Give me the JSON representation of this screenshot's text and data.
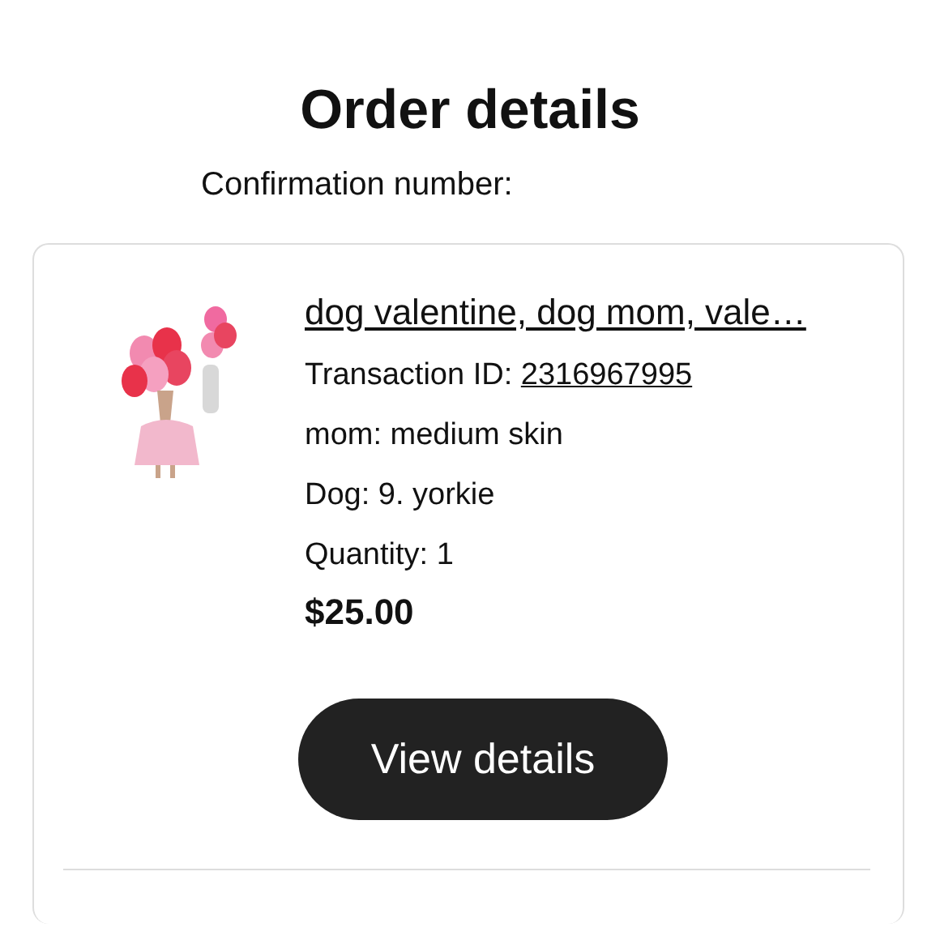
{
  "title": "Order details",
  "confirmation_label": "Confirmation number:",
  "order_item": {
    "product_title": "dog valentine, dog mom, vale…",
    "transaction_label": "Transaction ID:",
    "transaction_id": "2316967995",
    "options": [
      "mom: medium skin",
      "Dog: 9. yorkie",
      "Quantity: 1"
    ],
    "price": "$25.00",
    "button": "View details"
  }
}
